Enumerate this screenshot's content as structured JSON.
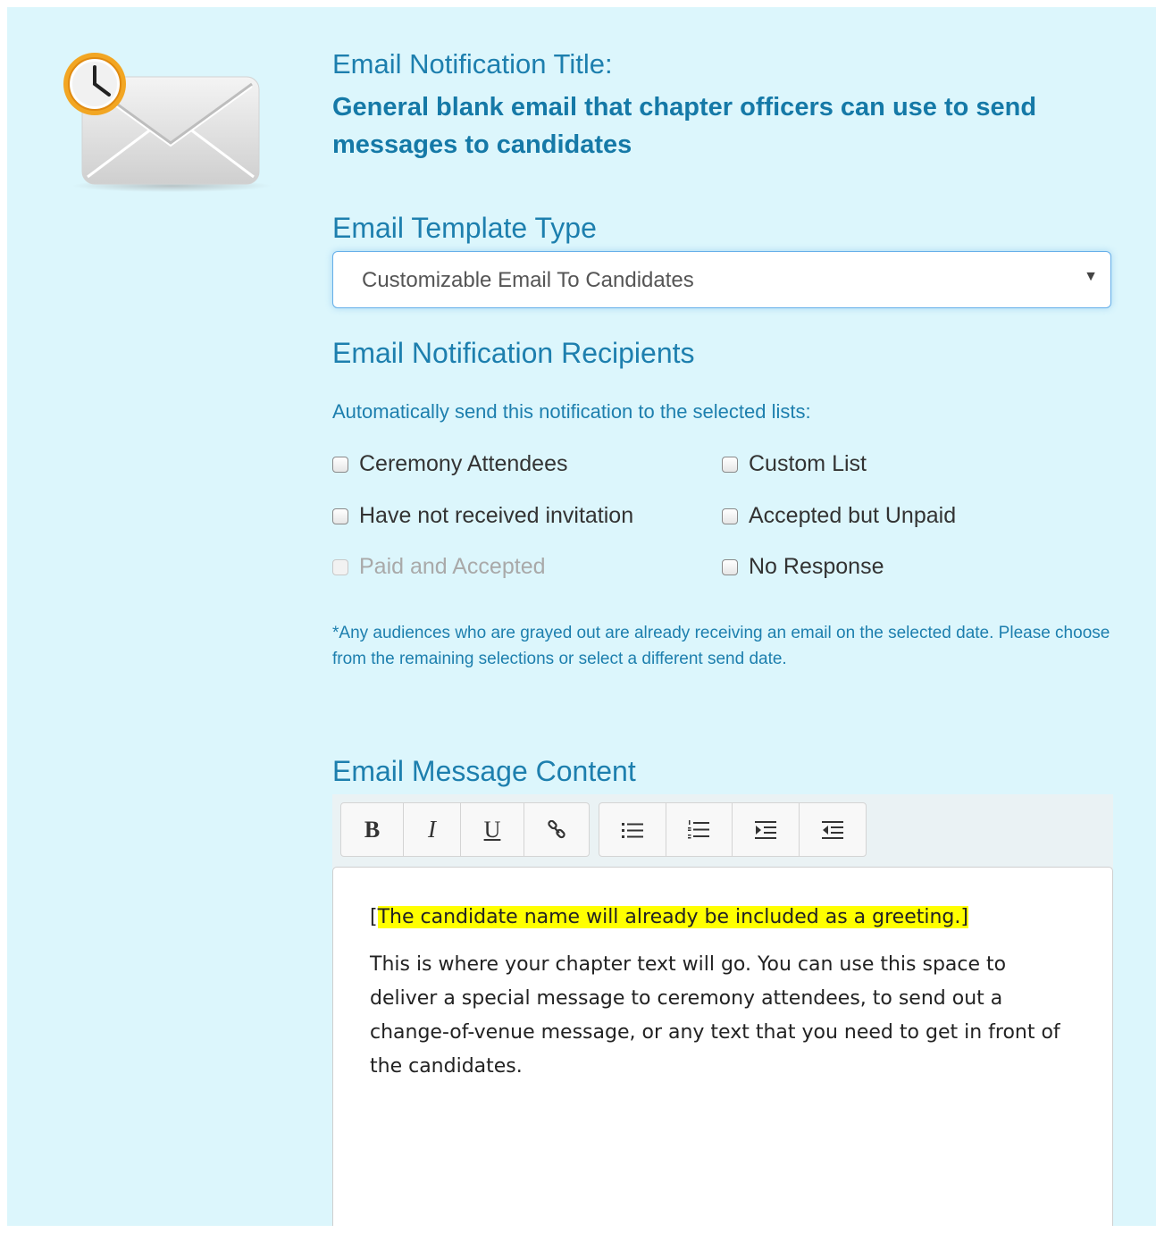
{
  "header": {
    "title_label": "Email Notification Title:",
    "title_value": "General blank email that chapter officers can use to send messages to candidates"
  },
  "template_type": {
    "heading": "Email Template Type",
    "selected": "Customizable Email To Candidates"
  },
  "recipients": {
    "heading": "Email Notification Recipients",
    "instructions": "Automatically send this notification to the selected lists:",
    "options": [
      {
        "label": "Ceremony Attendees",
        "checked": false,
        "disabled": false
      },
      {
        "label": "Have not received invitation",
        "checked": false,
        "disabled": false
      },
      {
        "label": "Paid and Accepted",
        "checked": false,
        "disabled": true
      },
      {
        "label": "Custom List",
        "checked": false,
        "disabled": false
      },
      {
        "label": "Accepted but Unpaid",
        "checked": false,
        "disabled": false
      },
      {
        "label": "No Response",
        "checked": false,
        "disabled": false
      }
    ],
    "note": "*Any audiences who are grayed out are already receiving an email on the selected date. Please choose from the remaining selections or select a different send date."
  },
  "message": {
    "heading": "Email Message Content",
    "toolbar": {
      "bold_label": "B",
      "italic_label": "I",
      "underline_label": "U",
      "icons": [
        "link-icon",
        "bullet-list-icon",
        "numbered-list-icon",
        "indent-icon",
        "outdent-icon"
      ]
    },
    "greeting_open": "[",
    "greeting_highlighted": "The candidate name will already be included as a greeting.]",
    "body": "This is where your chapter text will go. You can use this space to deliver a special message to ceremony attendees, to send out a change-of-venue message, or any text that you need to get in front of the candidates."
  },
  "colors": {
    "panel_background": "#dcf6fc",
    "heading_blue": "#1d7fae",
    "highlight": "#ffff00"
  }
}
